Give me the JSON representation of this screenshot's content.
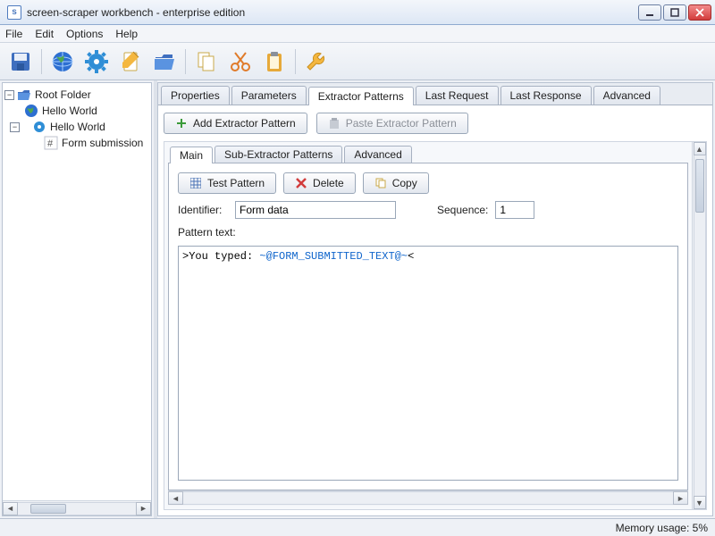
{
  "window": {
    "title": "screen-scraper workbench - enterprise edition"
  },
  "menu": {
    "file": "File",
    "edit": "Edit",
    "options": "Options",
    "help": "Help"
  },
  "toolbar_icons": {
    "save": "save-icon",
    "globe": "globe-icon",
    "gear": "gear-icon",
    "pencil": "pencil-icon",
    "folder": "folder-icon",
    "copy": "copy-icon",
    "cut": "scissors-icon",
    "paste": "clipboard-icon",
    "wrench": "wrench-icon"
  },
  "tree": {
    "root": "Root Folder",
    "session1": "Hello World",
    "session2": "Hello World",
    "scrapeable": "Form submission"
  },
  "top_tabs": {
    "properties": "Properties",
    "parameters": "Parameters",
    "extractor_patterns": "Extractor Patterns",
    "last_request": "Last Request",
    "last_response": "Last Response",
    "advanced": "Advanced"
  },
  "tab_buttons": {
    "add_extractor": "Add Extractor Pattern",
    "paste_extractor": "Paste Extractor Pattern"
  },
  "sub_tabs": {
    "main": "Main",
    "sub_extractor": "Sub-Extractor Patterns",
    "advanced": "Advanced"
  },
  "pattern_buttons": {
    "test": "Test Pattern",
    "delete": "Delete",
    "copy": "Copy"
  },
  "fields": {
    "identifier_label": "Identifier:",
    "identifier_value": "Form data",
    "sequence_label": "Sequence:",
    "sequence_value": "1",
    "pattern_text_label": "Pattern text:"
  },
  "pattern_text": {
    "prefix": ">You typed: ",
    "token_open": "~@",
    "token_name": "FORM_SUBMITTED_TEXT",
    "token_close": "@~",
    "suffix": "<"
  },
  "status": {
    "memory": "Memory usage: 5%"
  }
}
